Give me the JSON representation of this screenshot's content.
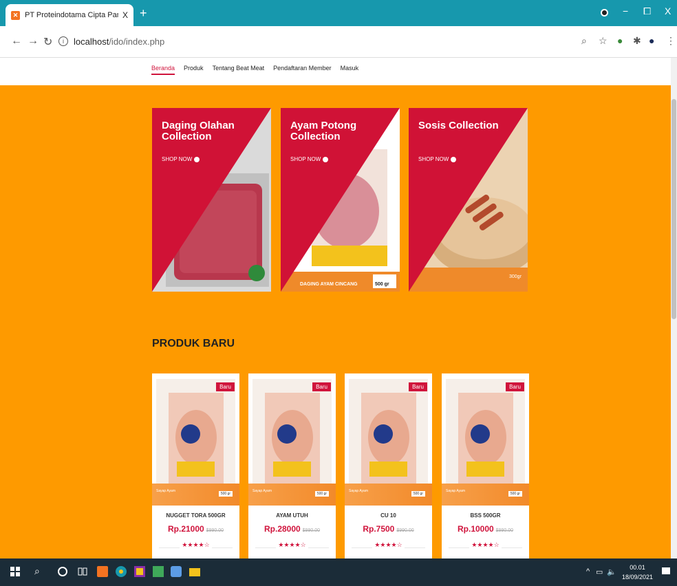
{
  "browser": {
    "tab_title": "PT Proteindotama Cipta Pangan",
    "tab_close": "X",
    "new_tab": "+",
    "url_host": "localhost",
    "url_path": "/ido/index.php",
    "win_min": "−",
    "win_max": "⧠",
    "win_close": "X"
  },
  "site_nav": [
    "Beranda",
    "Produk",
    "Tentang Beat Meat",
    "Pendaftaran Member",
    "Masuk"
  ],
  "banners": [
    {
      "title": "Daging Olahan Collection",
      "cta": "SHOP NOW"
    },
    {
      "title": "Ayam Potong Collection",
      "cta": "SHOP NOW"
    },
    {
      "title": "Sosis Collection",
      "cta": "SHOP NOW"
    }
  ],
  "banner_extras": {
    "b2_left": "DAGING AYAM CINCANG",
    "b2_right": "500 gr",
    "b3_right": "300gr"
  },
  "section_title": "PRODUK BARU",
  "products": [
    {
      "name": "NUGGET TORA 500GR",
      "price": "Rp.21000",
      "old_price": "$990.00",
      "badge": "Baru",
      "band_left": "Sayap Ayam",
      "band_right": "500 gr",
      "rating": 4
    },
    {
      "name": "AYAM UTUH",
      "price": "Rp.28000",
      "old_price": "$990.00",
      "badge": "Baru",
      "band_left": "Sayap Ayam",
      "band_right": "500 gr",
      "rating": 4
    },
    {
      "name": "CU 10",
      "price": "Rp.7500",
      "old_price": "$990.00",
      "badge": "Baru",
      "band_left": "Sayap Ayam",
      "band_right": "500 gr",
      "rating": 4
    },
    {
      "name": "BSS 500GR",
      "price": "Rp.10000",
      "old_price": "$990.00",
      "badge": "Baru",
      "band_left": "Sayap Ayam",
      "band_right": "500 gr",
      "rating": 4
    }
  ],
  "taskbar": {
    "time": "00.01",
    "date": "18/09/2021"
  },
  "colors": {
    "accent": "#d0143c",
    "orange": "#fe9a00",
    "chrome": "#1798ad"
  }
}
